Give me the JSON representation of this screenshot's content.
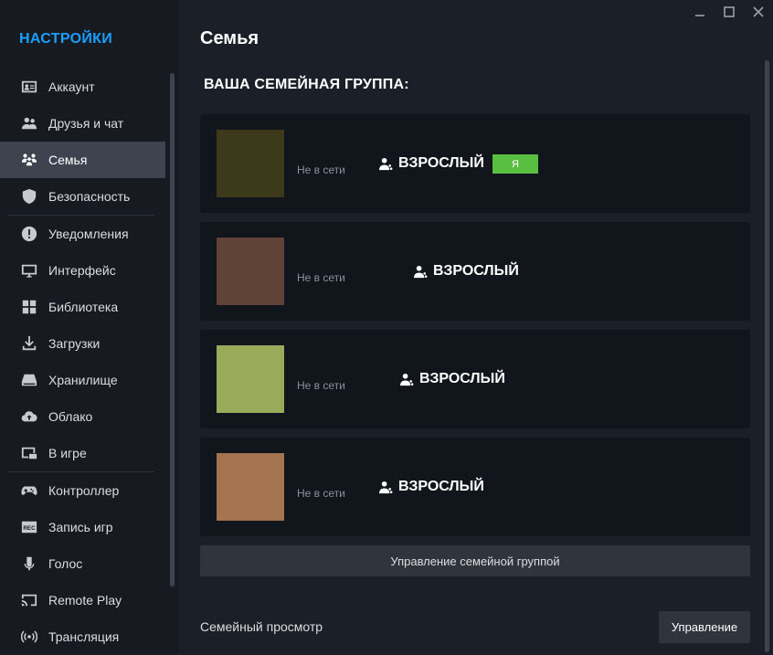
{
  "sidebar": {
    "title": "НАСТРОЙКИ",
    "items": [
      {
        "label": "Аккаунт",
        "icon": "account-card-icon"
      },
      {
        "label": "Друзья и чат",
        "icon": "friends-icon"
      },
      {
        "label": "Семья",
        "icon": "family-icon",
        "active": true
      },
      {
        "label": "Безопасность",
        "icon": "shield-icon"
      },
      {
        "label": "Уведомления",
        "icon": "notification-icon"
      },
      {
        "label": "Интерфейс",
        "icon": "monitor-icon"
      },
      {
        "label": "Библиотека",
        "icon": "library-grid-icon"
      },
      {
        "label": "Загрузки",
        "icon": "download-icon"
      },
      {
        "label": "Хранилище",
        "icon": "storage-icon"
      },
      {
        "label": "Облако",
        "icon": "cloud-icon"
      },
      {
        "label": "В игре",
        "icon": "in-game-icon"
      },
      {
        "label": "Контроллер",
        "icon": "controller-icon"
      },
      {
        "label": "Запись игр",
        "icon": "rec-icon"
      },
      {
        "label": "Голос",
        "icon": "microphone-icon"
      },
      {
        "label": "Remote Play",
        "icon": "remote-play-icon"
      },
      {
        "label": "Трансляция",
        "icon": "broadcast-icon"
      }
    ]
  },
  "main": {
    "page_title": "Семья",
    "section_title": "ВАША СЕМЕЙНАЯ ГРУППА:",
    "members": [
      {
        "status": "Не в сети",
        "role": "ВЗРОСЛЫЙ",
        "badge": "Я",
        "avatar_color": "#3d3a1c"
      },
      {
        "status": "Не в сети",
        "role": "ВЗРОСЛЫЙ",
        "avatar_color": "#5f4337"
      },
      {
        "status": "Не в сети",
        "role": "ВЗРОСЛЫЙ",
        "avatar_color": "#9aaa5b"
      },
      {
        "status": "Не в сети",
        "role": "ВЗРОСЛЫЙ",
        "avatar_color": "#a47451"
      }
    ],
    "manage_group_label": "Управление семейной группой",
    "family_view_label": "Семейный просмотр",
    "manage_label": "Управление"
  },
  "colors": {
    "accent": "#1a9fff",
    "badge_green": "#59bf40",
    "sidebar_bg": "#171a21",
    "main_bg": "#1b1f28",
    "card_bg": "#11151c"
  }
}
